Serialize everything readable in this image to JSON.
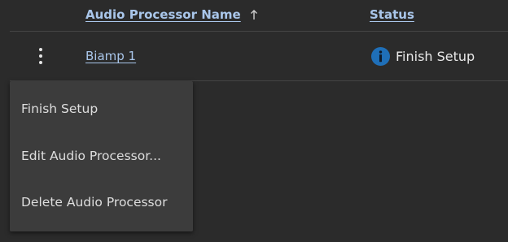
{
  "table": {
    "columns": [
      {
        "label": "Audio Processor Name",
        "sort": "ascending"
      },
      {
        "label": "Status"
      }
    ],
    "rows": [
      {
        "name": "Biamp 1",
        "status": "Finish Setup",
        "status_icon": "info-icon"
      }
    ]
  },
  "context_menu": {
    "items": [
      {
        "label": "Finish Setup"
      },
      {
        "label": "Edit Audio Processor..."
      },
      {
        "label": "Delete Audio Processor"
      }
    ]
  },
  "colors": {
    "background": "#2b2b2b",
    "link": "#a9c6ea",
    "info": "#1f6fb8",
    "menu_bg": "#3c3c3c"
  }
}
